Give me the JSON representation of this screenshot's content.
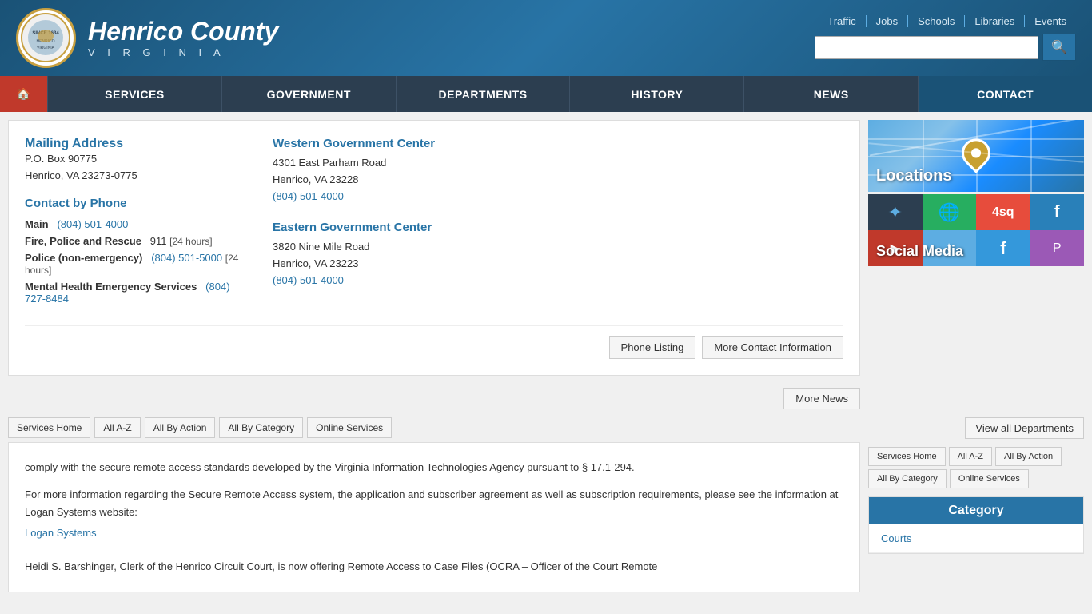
{
  "header": {
    "county_name": "Henrico County",
    "county_virginia": "V I R G I N I A",
    "top_links": [
      "Traffic",
      "Jobs",
      "Schools",
      "Libraries",
      "Events"
    ],
    "search_placeholder": ""
  },
  "nav": {
    "home_icon": "🏠",
    "items": [
      "SERVICES",
      "GOVERNMENT",
      "DEPARTMENTS",
      "HISTORY",
      "NEWS",
      "CONTACT"
    ]
  },
  "contact": {
    "mailing_title": "Mailing Address",
    "mailing_line1": "P.O. Box 90775",
    "mailing_line2": "Henrico, VA 23273-0775",
    "phone_title": "Contact by Phone",
    "phones": [
      {
        "label": "Main",
        "number": "(804) 501-4000",
        "note": ""
      },
      {
        "label": "Fire, Police and Rescue",
        "number": "911",
        "note": "[24 hours]"
      },
      {
        "label": "Police (non-emergency)",
        "number": "(804) 501-5000",
        "note": "[24 hours]"
      },
      {
        "label": "Mental Health Emergency Services",
        "number": "(804) 727-8484",
        "note": ""
      }
    ],
    "western_title": "Western Government Center",
    "western_addr1": "4301 East Parham Road",
    "western_addr2": "Henrico, VA 23228",
    "western_phone": "(804) 501-4000",
    "eastern_title": "Eastern Government Center",
    "eastern_addr1": "3820 Nine Mile Road",
    "eastern_addr2": "Henrico, VA 23223",
    "eastern_phone": "(804) 501-4000",
    "btn_phone": "Phone Listing",
    "btn_more_contact": "More Contact Information"
  },
  "more_news_btn": "More News",
  "view_all_btn": "View all Departments",
  "locations_label": "Locations",
  "social_label": "Social Media",
  "service_nav": [
    "Services Home",
    "All A-Z",
    "All By Action",
    "All By Category",
    "Online Services"
  ],
  "category": {
    "title": "Category",
    "items": [
      "Courts"
    ]
  },
  "main_content": {
    "para1": "comply with the secure remote access standards developed by the Virginia Information Technologies Agency pursuant to § 17.1-294.",
    "para2": "For more information regarding the Secure Remote Access system, the application and subscriber agreement as well as subscription requirements, please see the information at Logan Systems website:",
    "logan_link": "Logan Systems",
    "para3": "Heidi S. Barshinger, Clerk of the Henrico Circuit Court, is now offering Remote Access to Case Files (OCRA – Officer of the Court Remote"
  }
}
